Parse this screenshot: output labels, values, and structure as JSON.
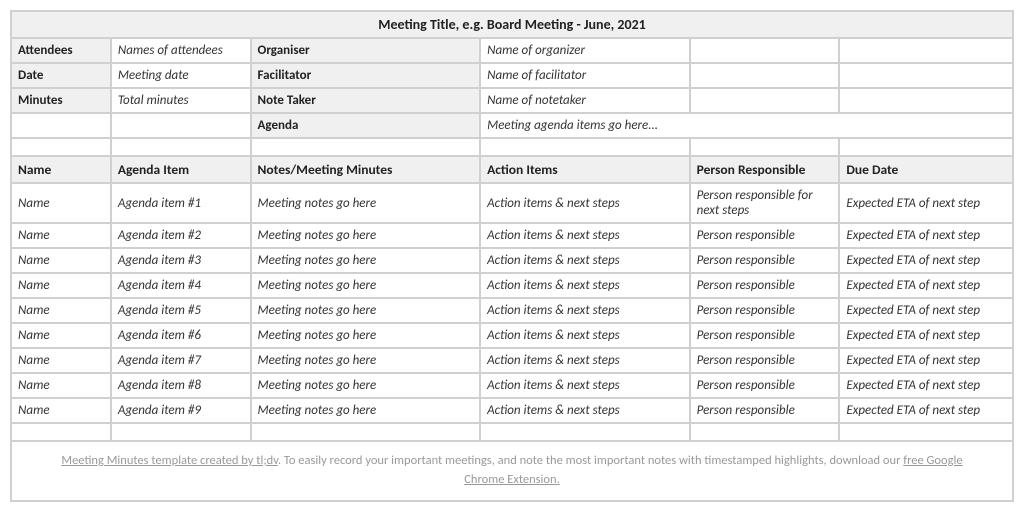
{
  "title": "Meeting Title, e.g. Board Meeting - June, 2021",
  "meta": {
    "attendees_label": "Attendees",
    "attendees_value": "Names of attendees",
    "organiser_label": "Organiser",
    "organiser_value": "Name of organizer",
    "date_label": "Date",
    "date_value": "Meeting date",
    "facilitator_label": "Facilitator",
    "facilitator_value": "Name of facilitator",
    "minutes_label": "Minutes",
    "minutes_value": "Total minutes",
    "notetaker_label": "Note Taker",
    "notetaker_value": "Name of notetaker",
    "agenda_label": "Agenda",
    "agenda_value": "Meeting agenda items go here..."
  },
  "columns": {
    "name": "Name",
    "agenda_item": "Agenda Item",
    "notes": "Notes/Meeting Minutes",
    "action_items": "Action Items",
    "person": "Person Responsible",
    "due": "Due Date"
  },
  "rows": [
    {
      "name": "Name",
      "agenda": "Agenda item #1",
      "notes": "Meeting notes go here",
      "actions": "Action items & next steps",
      "person": "Person responsible for next steps",
      "due": "Expected ETA of next step"
    },
    {
      "name": "Name",
      "agenda": "Agenda item #2",
      "notes": "Meeting notes go here",
      "actions": "Action items & next steps",
      "person": "Person responsible",
      "due": "Expected ETA of next step"
    },
    {
      "name": "Name",
      "agenda": "Agenda item #3",
      "notes": "Meeting notes go here",
      "actions": "Action items & next steps",
      "person": "Person responsible",
      "due": "Expected ETA of next step"
    },
    {
      "name": "Name",
      "agenda": "Agenda item #4",
      "notes": "Meeting notes go here",
      "actions": "Action items & next steps",
      "person": "Person responsible",
      "due": "Expected ETA of next step"
    },
    {
      "name": "Name",
      "agenda": "Agenda item #5",
      "notes": "Meeting notes go here",
      "actions": "Action items & next steps",
      "person": "Person responsible",
      "due": "Expected ETA of next step"
    },
    {
      "name": "Name",
      "agenda": "Agenda item #6",
      "notes": "Meeting notes go here",
      "actions": "Action items & next steps",
      "person": "Person responsible",
      "due": "Expected ETA of next step"
    },
    {
      "name": "Name",
      "agenda": "Agenda item #7",
      "notes": "Meeting notes go here",
      "actions": "Action items & next steps",
      "person": "Person responsible",
      "due": "Expected ETA of next step"
    },
    {
      "name": "Name",
      "agenda": "Agenda item #8",
      "notes": "Meeting notes go here",
      "actions": "Action items & next steps",
      "person": "Person responsible",
      "due": "Expected ETA of next step"
    },
    {
      "name": "Name",
      "agenda": "Agenda item #9",
      "notes": "Meeting notes go here",
      "actions": "Action items & next steps",
      "person": "Person responsible",
      "due": "Expected ETA of next step"
    }
  ],
  "footer": {
    "link1": "Meeting Minutes template created by tl;dv",
    "text1": ". To easily record your important meetings, and note the most important notes with timestamped highlights, download our ",
    "link2": "free Google Chrome Extension."
  }
}
